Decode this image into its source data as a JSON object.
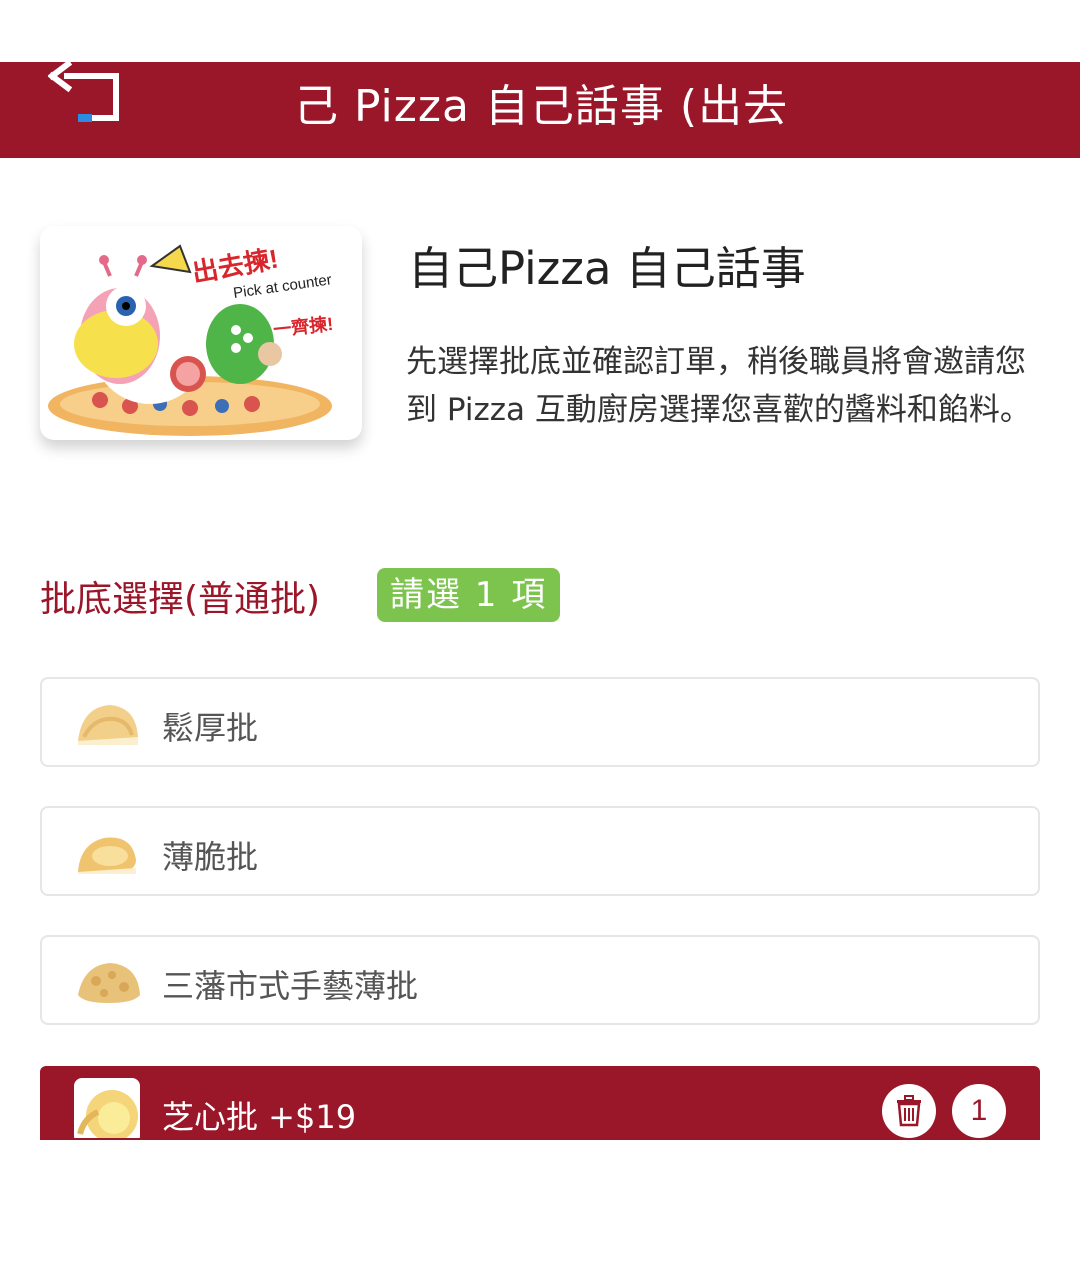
{
  "header": {
    "title": "己 Pizza 自己話事 (出去"
  },
  "shop": {
    "banner_text_main": "出去揀!",
    "banner_text_sub": "Pick at counter",
    "banner_text_extra": "一齊揀!",
    "name": "自己Pizza 自己話事",
    "description": "先選擇批底並確認訂單，稍後職員將會邀請您到 Pizza 互動廚房選擇您喜歡的醬料和餡料。"
  },
  "section": {
    "title": "批底選擇(普通批)",
    "badge": "請選 1 項"
  },
  "options": [
    {
      "label": "鬆厚批",
      "selected": false
    },
    {
      "label": "薄脆批",
      "selected": false
    },
    {
      "label": "三藩市式手藝薄批",
      "selected": false
    },
    {
      "label": "芝心批 +$19",
      "selected": true,
      "quantity": "1"
    }
  ],
  "colors": {
    "brand": "#9a1729",
    "badge_green": "#7dc44f"
  },
  "icons": {
    "back": "back-arrow-icon",
    "trash": "trash-icon"
  }
}
